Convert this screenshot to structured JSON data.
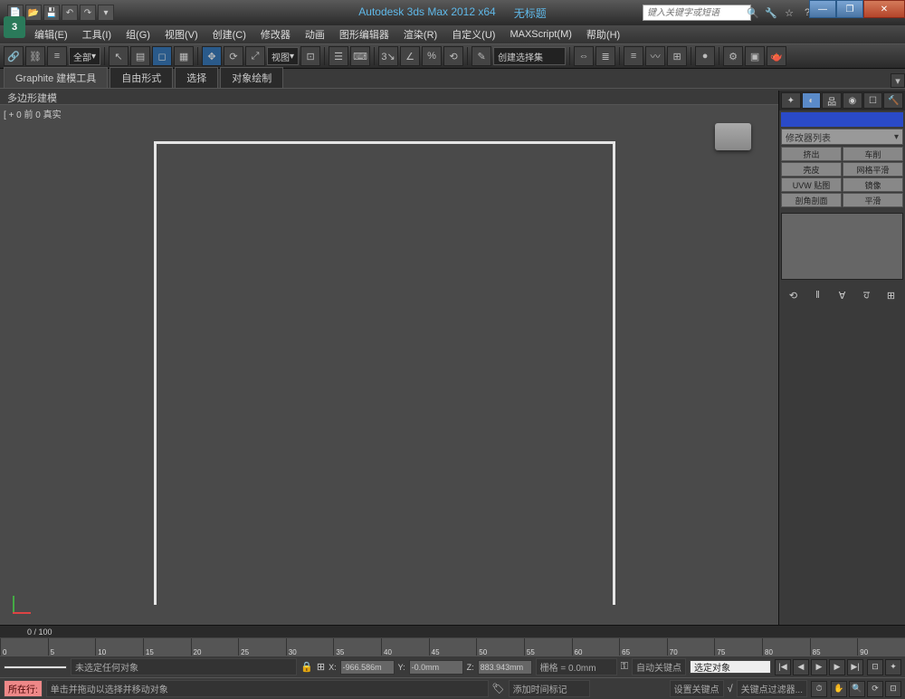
{
  "app": {
    "name": "Autodesk 3ds Max 2012 x64",
    "doc": "无标题",
    "search_placeholder": "键入关键字或短语"
  },
  "menus": [
    "编辑(E)",
    "工具(I)",
    "组(G)",
    "视图(V)",
    "创建(C)",
    "修改器",
    "动画",
    "图形编辑器",
    "渲染(R)",
    "自定义(U)",
    "MAXScript(M)",
    "帮助(H)"
  ],
  "toolbar": {
    "filter": "全部",
    "view": "视图",
    "create_dropdown": "创建选择集"
  },
  "ribbon": {
    "tabs": [
      "Graphite 建模工具",
      "自由形式",
      "选择",
      "对象绘制"
    ],
    "sub": "多边形建模"
  },
  "viewport": {
    "label": "[ + 0 前 0 真实"
  },
  "command_panel": {
    "modifier_list": "修改器列表",
    "buttons": [
      {
        "l": "挤出",
        "r": "车削"
      },
      {
        "l": "壳皮",
        "r": "网格平滑"
      },
      {
        "l": "UVW 贴图",
        "r": "镜像"
      },
      {
        "l": "剖角剖面",
        "r": "平滑"
      }
    ]
  },
  "timeline": {
    "range": "0 / 100",
    "ticks": [
      "0",
      "5",
      "10",
      "15",
      "20",
      "25",
      "30",
      "35",
      "40",
      "45",
      "50",
      "55",
      "60",
      "65",
      "70",
      "75",
      "80",
      "85",
      "90"
    ]
  },
  "status": {
    "none_selected": "未选定任何对象",
    "hint": "单击并拖动以选择并移动对象",
    "x": "-966.586m",
    "y": "-0.0mm",
    "z": "883.943mm",
    "grid": "栅格 = 0.0mm",
    "row_label": "所在行:",
    "add_time_tag": "添加时间标记",
    "auto_key": "自动关键点",
    "set_key": "设置关键点",
    "sel_obj": "选定对象",
    "key_filter": "关键点过滤器..."
  }
}
